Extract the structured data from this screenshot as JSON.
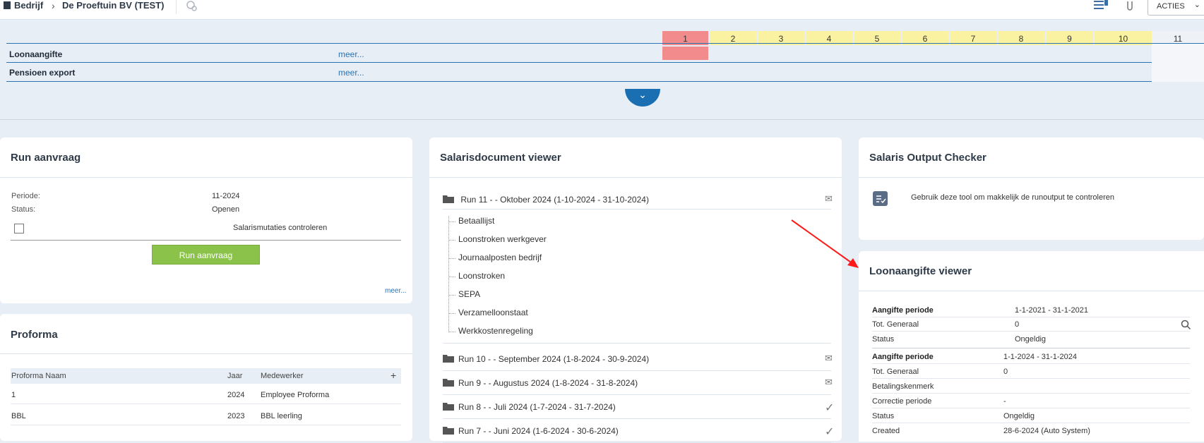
{
  "topbar": {
    "crumb_company": "Bedrijf",
    "crumb_client": "De Proeftuin BV (TEST)",
    "acties_label": "ACTIES"
  },
  "timeline": {
    "periods": [
      "1",
      "2",
      "3",
      "4",
      "5",
      "6",
      "7",
      "8",
      "9",
      "10",
      "11"
    ],
    "rows": [
      {
        "label": "Loonaangifte",
        "meer": "meer..."
      },
      {
        "label": "Pensioen export",
        "meer": "meer..."
      }
    ]
  },
  "run_aanvraag": {
    "title": "Run aanvraag",
    "periode_label": "Periode:",
    "periode_value": "11-2024",
    "status_label": "Status:",
    "status_value": "Openen",
    "checkbox_label": "Salarismutaties controleren",
    "button_label": "Run aanvraag",
    "meer": "meer..."
  },
  "proforma": {
    "title": "Proforma",
    "headers": [
      "Proforma Naam",
      "Jaar",
      "Medewerker"
    ],
    "add": "+",
    "rows": [
      {
        "naam": "1",
        "jaar": "2024",
        "medewerker": "Employee Proforma"
      },
      {
        "naam": "BBL",
        "jaar": "2023",
        "medewerker": "BBL leerling"
      }
    ]
  },
  "salarisdocument": {
    "title": "Salarisdocument viewer",
    "run11": "Run 11 - - Oktober 2024 (1-10-2024 - 31-10-2024)",
    "children": [
      "Betaallijst",
      "Loonstroken werkgever",
      "Journaalposten bedrijf",
      "Loonstroken",
      "SEPA",
      "Verzamelloonstaat",
      "Werkkostenregeling"
    ],
    "runs": [
      "Run 10 - - September 2024 (1-8-2024 - 30-9-2024)",
      "Run 9 - - Augustus 2024 (1-8-2024 - 31-8-2024)",
      "Run 8 - - Juli 2024 (1-7-2024 - 31-7-2024)",
      "Run 7 - - Juni 2024 (1-6-2024 - 30-6-2024)"
    ]
  },
  "output_checker": {
    "title": "Salaris Output Checker",
    "description": "Gebruik deze tool om makkelijk de runoutput te controleren"
  },
  "loonaangifte_viewer": {
    "title": "Loonaangifte viewer",
    "block1": {
      "periode_label": "Aangifte periode",
      "periode_value": "1-1-2021 - 31-1-2021",
      "totaal_label": "Tot. Generaal",
      "totaal_value": "0",
      "status_label": "Status",
      "status_value": "Ongeldig"
    },
    "block2": {
      "periode_label": "Aangifte periode",
      "periode_value": "1-1-2024 - 31-1-2024",
      "totaal_label": "Tot. Generaal",
      "totaal_value": "0",
      "betaling_label": "Betalingskenmerk",
      "correctie_label": "Correctie periode",
      "correctie_value": "-",
      "status_label": "Status",
      "status_value": "Ongeldig",
      "created_label": "Created",
      "created_value": "28-6-2024 (Auto System)"
    }
  },
  "colors": {
    "accent": "#1a6fb3",
    "current_period": "#f28b8b",
    "period_yellow": "#faf2a0",
    "button_green": "#8bc34a"
  }
}
